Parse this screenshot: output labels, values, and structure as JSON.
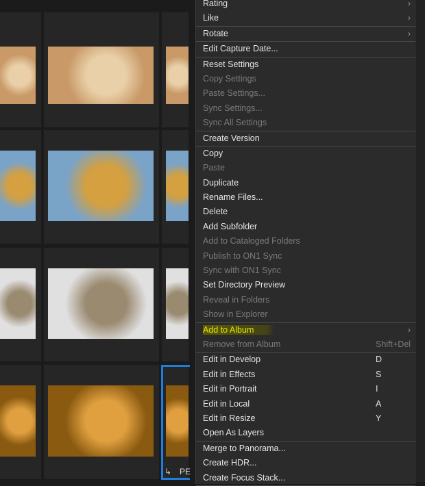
{
  "menu": {
    "items": [
      {
        "label": "Rating",
        "submenu": true
      },
      {
        "label": "Like",
        "submenu": true,
        "sep_after": true
      },
      {
        "label": "Rotate",
        "submenu": true,
        "sep_after": true
      },
      {
        "label": "Edit Capture Date...",
        "sep_after": true
      },
      {
        "label": "Reset Settings"
      },
      {
        "label": "Copy Settings",
        "disabled": true
      },
      {
        "label": "Paste Settings...",
        "disabled": true
      },
      {
        "label": "Sync Settings...",
        "disabled": true
      },
      {
        "label": "Sync All Settings",
        "disabled": true,
        "sep_after": true
      },
      {
        "label": "Create Version",
        "sep_after": true
      },
      {
        "label": "Copy"
      },
      {
        "label": "Paste",
        "disabled": true
      },
      {
        "label": "Duplicate"
      },
      {
        "label": "Rename Files..."
      },
      {
        "label": "Delete"
      },
      {
        "label": "Add Subfolder"
      },
      {
        "label": "Add to Cataloged Folders",
        "disabled": true
      },
      {
        "label": "Publish to ON1 Sync",
        "disabled": true
      },
      {
        "label": "Sync with ON1 Sync",
        "disabled": true
      },
      {
        "label": "Set Directory Preview"
      },
      {
        "label": "Reveal in Folders",
        "disabled": true
      },
      {
        "label": "Show in Explorer",
        "disabled": true,
        "sep_after": true
      },
      {
        "label": "Add to Album",
        "submenu": true,
        "highlighted": true
      },
      {
        "label": "Remove from Album",
        "disabled": true,
        "shortcut": "Shift+Del",
        "sep_after": true
      },
      {
        "label": "Edit in Develop",
        "shortcut": "D"
      },
      {
        "label": "Edit in Effects",
        "shortcut": "S"
      },
      {
        "label": "Edit in Portrait",
        "shortcut": "I"
      },
      {
        "label": "Edit in Local",
        "shortcut": "A"
      },
      {
        "label": "Edit in Resize",
        "shortcut": "Y"
      },
      {
        "label": "Open As Layers",
        "sep_after": true
      },
      {
        "label": "Merge to Panorama..."
      },
      {
        "label": "Create HDR..."
      },
      {
        "label": "Create Focus Stack...",
        "sep_after": true
      }
    ]
  },
  "grid": {
    "selected_label": "PE",
    "selection_color": "#1e7de0"
  },
  "icons": {
    "submenu": "chevron-right-icon",
    "selected": "corner-arrow-icon"
  }
}
